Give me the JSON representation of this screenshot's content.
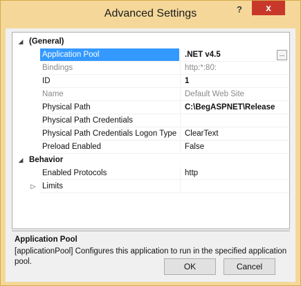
{
  "window": {
    "title": "Advanced Settings",
    "help_label": "?",
    "close_label": "x"
  },
  "grid": {
    "categories": [
      {
        "label": "(General)",
        "expanded": true,
        "rows": [
          {
            "name": "Application Pool",
            "value": ".NET v4.5",
            "selected": true,
            "bold": true,
            "has_ellipsis": true,
            "ellipsis_label": "..."
          },
          {
            "name": "Bindings",
            "value": "http:*:80:",
            "disabled": true
          },
          {
            "name": "ID",
            "value": "1",
            "bold": true
          },
          {
            "name": "Name",
            "value": "Default Web Site",
            "disabled": true
          },
          {
            "name": "Physical Path",
            "value": "C:\\BegASPNET\\Release",
            "bold": true
          },
          {
            "name": "Physical Path Credentials",
            "value": ""
          },
          {
            "name": "Physical Path Credentials Logon Type",
            "value": "ClearText"
          },
          {
            "name": "Preload Enabled",
            "value": "False"
          }
        ]
      },
      {
        "label": "Behavior",
        "expanded": true,
        "rows": [
          {
            "name": "Enabled Protocols",
            "value": "http"
          }
        ]
      }
    ],
    "collapsed_rows": [
      {
        "name": "Limits",
        "value": ""
      }
    ]
  },
  "description": {
    "title": "Application Pool",
    "text": "[applicationPool] Configures this application to run in the specified application pool."
  },
  "buttons": {
    "ok": "OK",
    "cancel": "Cancel"
  },
  "colors": {
    "title_bar": "#f5d899",
    "close_button": "#c7382b",
    "selection": "#3399ff"
  }
}
